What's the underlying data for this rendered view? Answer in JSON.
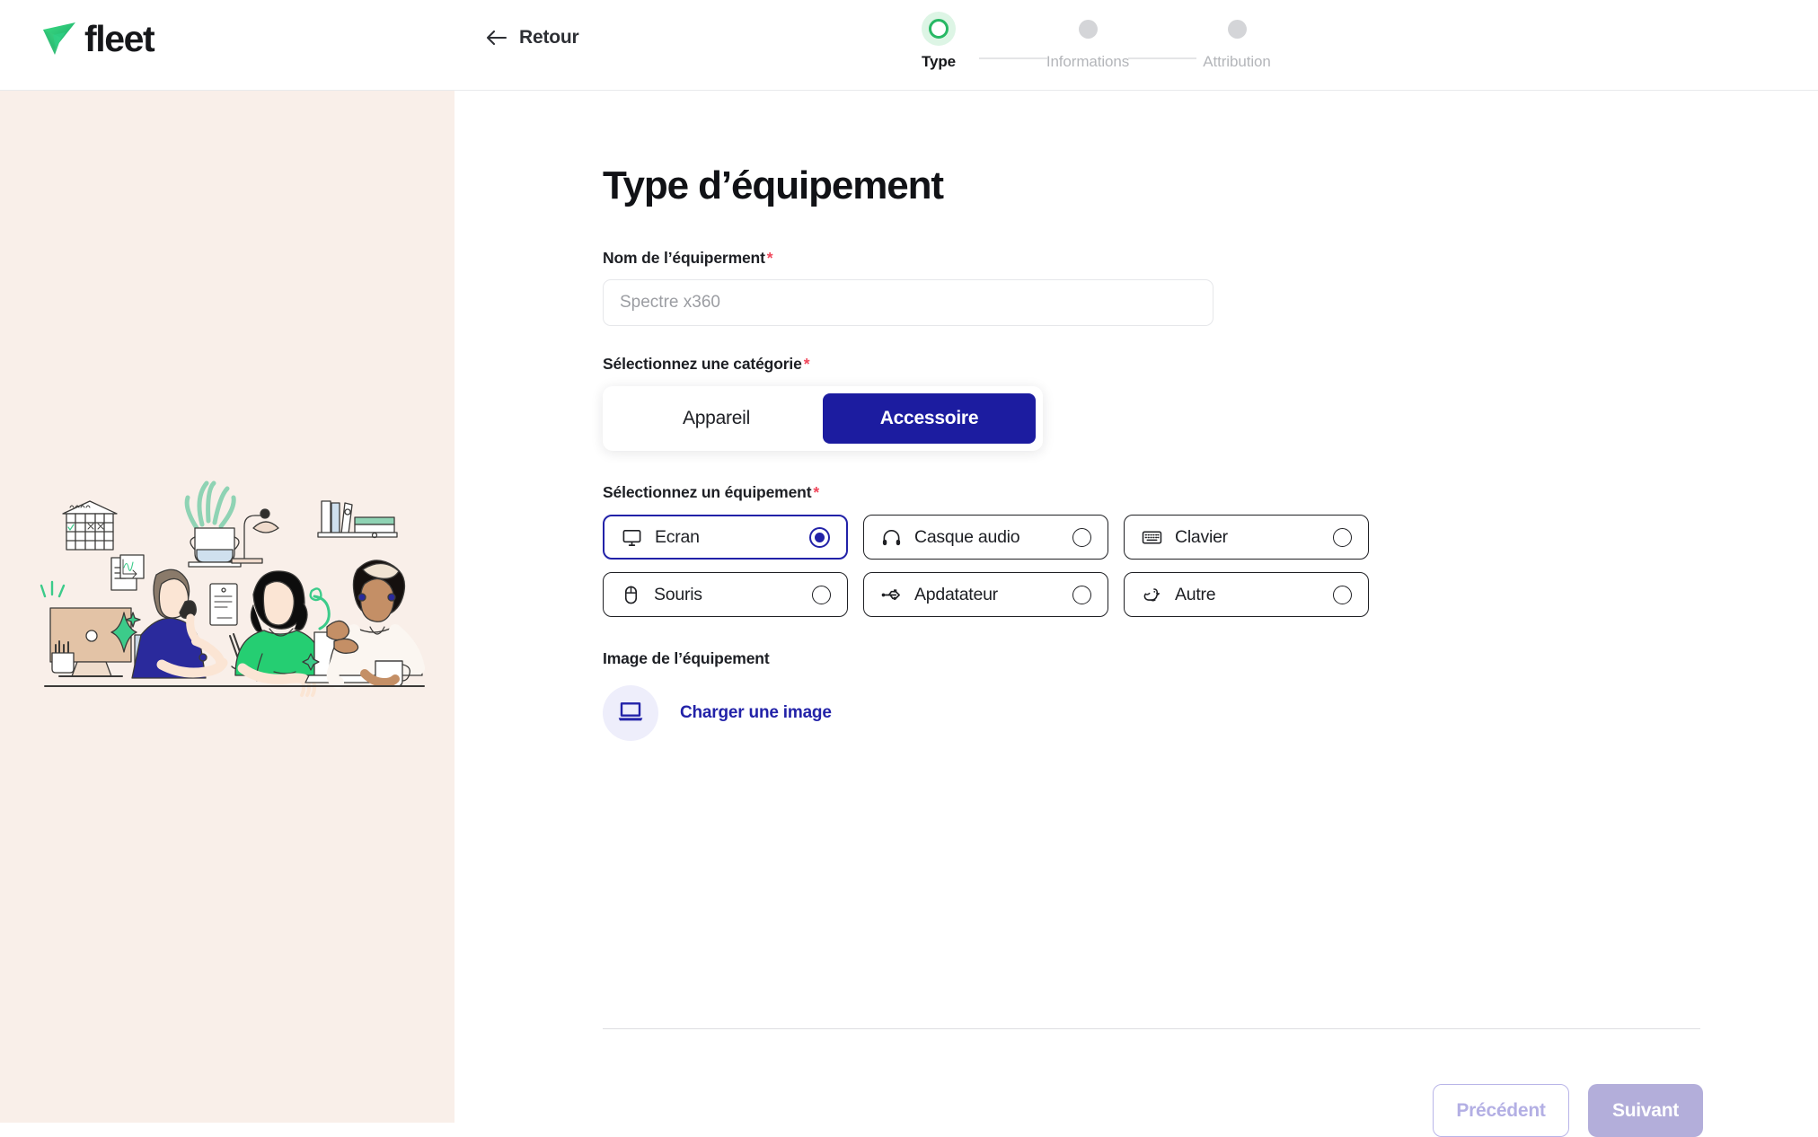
{
  "brand": {
    "name": "fleet",
    "logo_icon": "fleet-arrow-logo",
    "green": "#2ec27e"
  },
  "topbar": {
    "back_label": "Retour",
    "back_icon": "arrow-left-icon"
  },
  "stepper": {
    "active_color": "#27b864",
    "idle_color": "#d4d5d8",
    "steps": [
      {
        "label": "Type",
        "state": "active"
      },
      {
        "label": "Informations",
        "state": "idle"
      },
      {
        "label": "Attribution",
        "state": "idle"
      }
    ]
  },
  "sidebar": {
    "background": "#f9efe9",
    "illustration": "office-team-illustration"
  },
  "main": {
    "title": "Type d’équipement",
    "name_field": {
      "label": "Nom de l’équiperment",
      "required_mark": "*",
      "value": "",
      "placeholder": "Spectre x360"
    },
    "category": {
      "label": "Sélectionnez une catégorie",
      "required_mark": "*",
      "selected": "Accessoire",
      "options": [
        {
          "label": "Appareil",
          "selected": false
        },
        {
          "label": "Accessoire",
          "selected": true
        }
      ],
      "active_color": "#1c1ca0"
    },
    "equipment": {
      "label": "Sélectionnez un équipement",
      "required_mark": "*",
      "selected": "Ecran",
      "accent": "#2222a8",
      "options": [
        {
          "label": "Ecran",
          "icon": "monitor-icon",
          "selected": true
        },
        {
          "label": "Casque audio",
          "icon": "headphones-icon",
          "selected": false
        },
        {
          "label": "Clavier",
          "icon": "keyboard-icon",
          "selected": false
        },
        {
          "label": "Souris",
          "icon": "mouse-icon",
          "selected": false
        },
        {
          "label": "Apdatateur",
          "icon": "usb-icon",
          "selected": false
        },
        {
          "label": "Autre",
          "icon": "duck-icon",
          "selected": false
        }
      ]
    },
    "image": {
      "label": "Image de l’équipement",
      "upload_icon": "laptop-icon",
      "upload_label": "Charger une image"
    }
  },
  "footer": {
    "previous_label": "Précédent",
    "next_label": "Suivant",
    "previous_disabled": true,
    "next_disabled": true
  }
}
